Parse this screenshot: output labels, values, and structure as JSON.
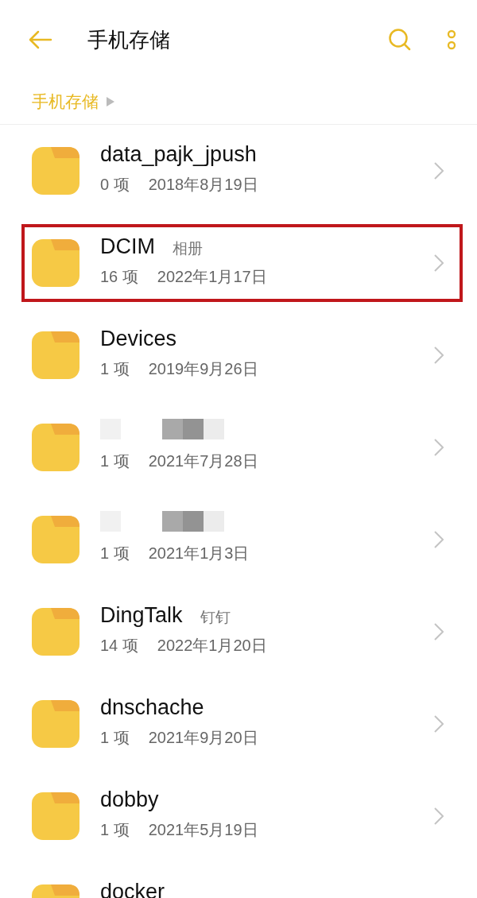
{
  "header": {
    "title": "手机存储"
  },
  "breadcrumb": [
    {
      "label": "手机存储"
    }
  ],
  "folders": [
    {
      "name": "data_pajk_jpush",
      "count": "0 项",
      "date": "2018年8月19日",
      "highlighted": false,
      "name_redacted": false
    },
    {
      "name": "DCIM",
      "alias": "相册",
      "count": "16 项",
      "date": "2022年1月17日",
      "highlighted": true,
      "name_redacted": false
    },
    {
      "name": "Devices",
      "count": "1 项",
      "date": "2019年9月26日",
      "highlighted": false,
      "name_redacted": false
    },
    {
      "count": "1 项",
      "date": "2021年7月28日",
      "highlighted": false,
      "name_redacted": true
    },
    {
      "count": "1 项",
      "date": "2021年1月3日",
      "highlighted": false,
      "name_redacted": true
    },
    {
      "name": "DingTalk",
      "alias": "钉钉",
      "count": "14 项",
      "date": "2022年1月20日",
      "highlighted": false,
      "name_redacted": false
    },
    {
      "name": "dnschache",
      "count": "1 项",
      "date": "2021年9月20日",
      "highlighted": false,
      "name_redacted": false
    },
    {
      "name": "dobby",
      "count": "1 项",
      "date": "2021年5月19日",
      "highlighted": false,
      "name_redacted": false
    },
    {
      "name": "docker",
      "highlighted": false,
      "name_redacted": false
    }
  ]
}
